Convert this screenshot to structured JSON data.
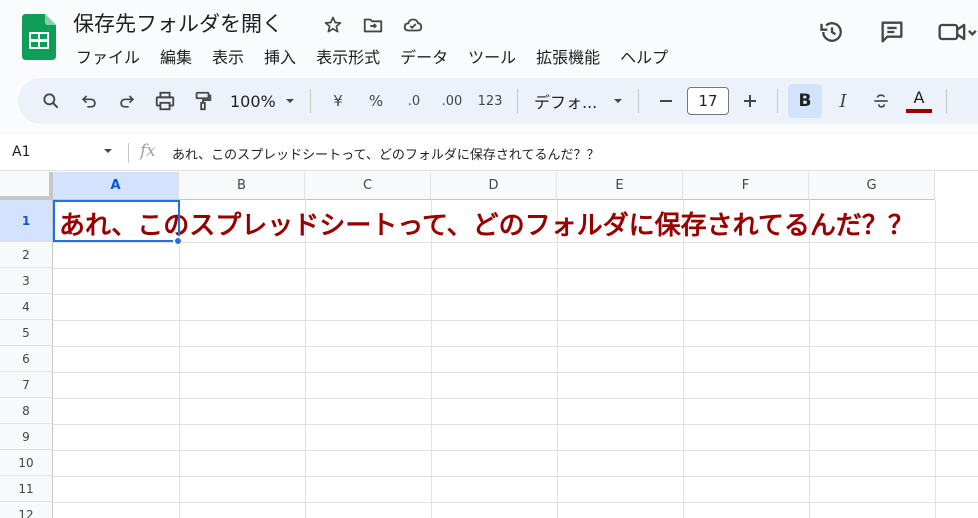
{
  "doc_title": "保存先フォルダを開く",
  "menu": [
    "ファイル",
    "編集",
    "表示",
    "挿入",
    "表示形式",
    "データ",
    "ツール",
    "拡張機能",
    "ヘルプ"
  ],
  "toolbar": {
    "zoom": "100%",
    "currency": "¥",
    "percent": "%",
    "decrease_decimal": ".0",
    "increase_decimal": ".00",
    "number_format": "123",
    "font": "デフォ...",
    "font_size": "17",
    "bold": "B",
    "italic": "I",
    "text_color": "A"
  },
  "namebox": "A1",
  "formula": "あれ、このスプレッドシートって、どのフォルダに保存されてるんだ？？",
  "columns": [
    "A",
    "B",
    "C",
    "D",
    "E",
    "F",
    "G"
  ],
  "rows": [
    "1",
    "2",
    "3",
    "4",
    "5",
    "6",
    "7",
    "8",
    "9",
    "10",
    "11",
    "12"
  ],
  "cell_a1": "あれ、このスプレッドシートって、どのフォルダに保存されてるんだ？？",
  "colors": {
    "accent": "#1a73e8",
    "cell_text": "#980000",
    "sheets_green": "#0f9d58"
  }
}
